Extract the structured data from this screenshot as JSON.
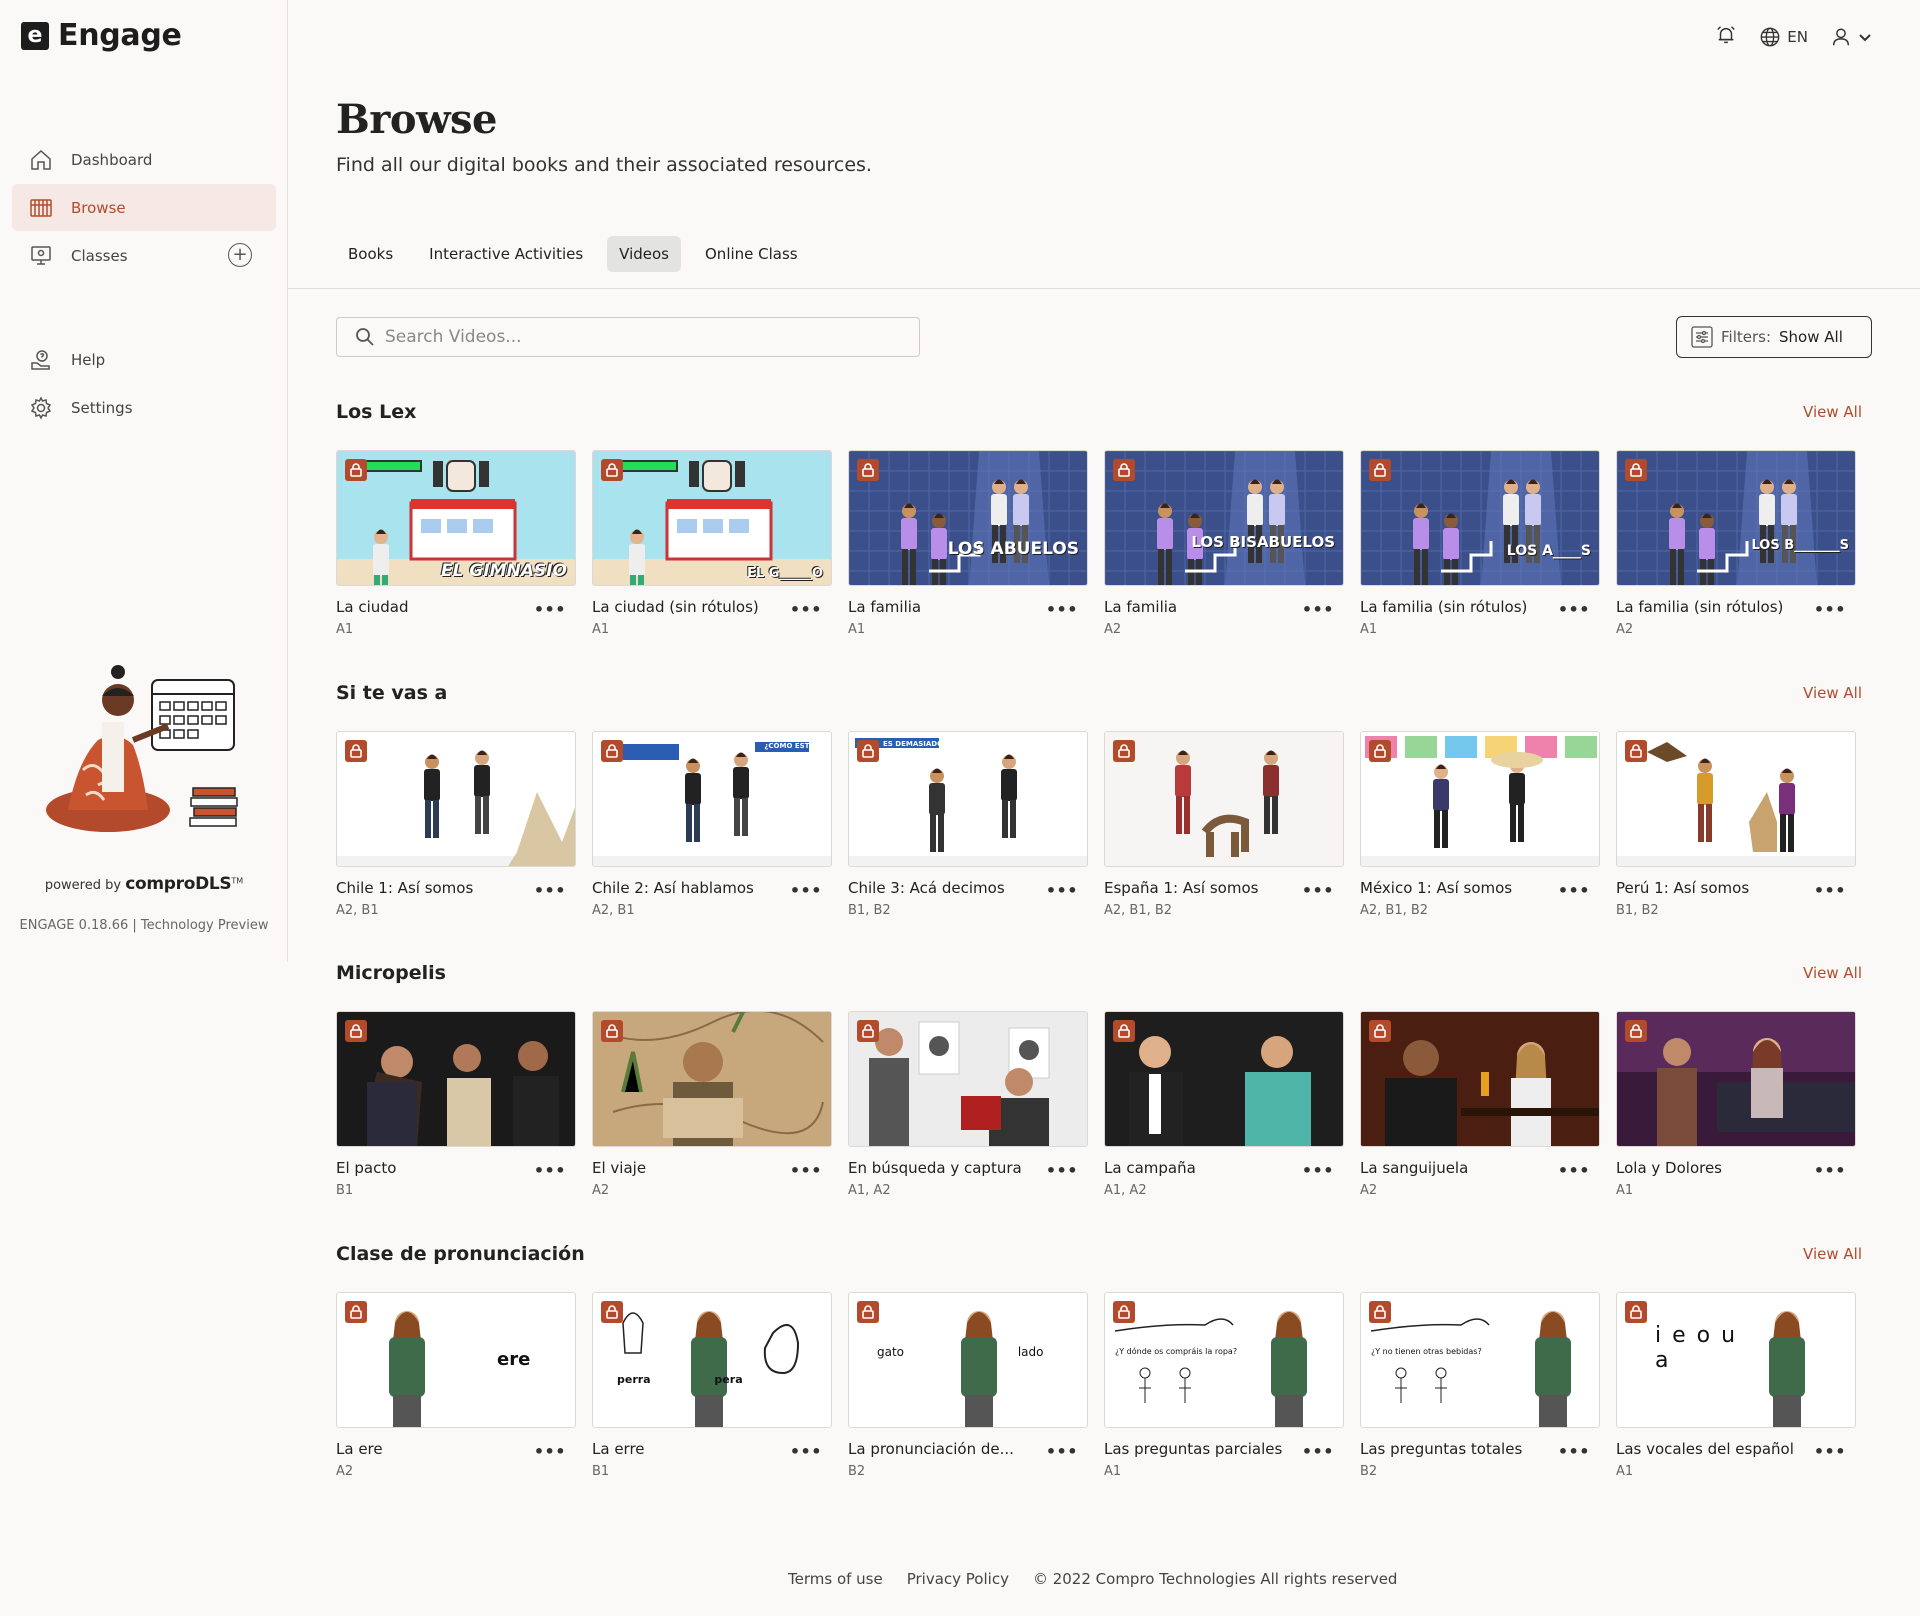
{
  "app": {
    "name": "Engage",
    "logo_letter": "e"
  },
  "topbar": {
    "language": "EN"
  },
  "sidebar": {
    "items": [
      {
        "label": "Dashboard",
        "icon": "home-icon"
      },
      {
        "label": "Browse",
        "icon": "browse-icon",
        "active": true
      },
      {
        "label": "Classes",
        "icon": "classes-icon"
      }
    ],
    "items2": [
      {
        "label": "Help",
        "icon": "help-icon"
      },
      {
        "label": "Settings",
        "icon": "gear-icon"
      }
    ],
    "powered_prefix": "powered by",
    "powered_brand": "comproDLS",
    "powered_tm": "TM",
    "version": "ENGAGE 0.18.66 | Technology Preview"
  },
  "header": {
    "title": "Browse",
    "subtitle": "Find all our digital books and their associated resources."
  },
  "tabs": [
    {
      "label": "Books"
    },
    {
      "label": "Interactive Activities"
    },
    {
      "label": "Videos",
      "active": true
    },
    {
      "label": "Online Class"
    }
  ],
  "search": {
    "placeholder": "Search Videos..."
  },
  "filter": {
    "label": "Filters:",
    "value": "Show All"
  },
  "view_all_label": "View All",
  "more_label": "•••",
  "sections": [
    {
      "title": "Los Lex",
      "cards": [
        {
          "title": "La ciudad",
          "level": "A1",
          "thumb_text": "EL GIMNASIO"
        },
        {
          "title": "La ciudad (sin rótulos)",
          "level": "A1",
          "thumb_text": "EL G_____O"
        },
        {
          "title": "La familia",
          "level": "A1",
          "thumb_text": "LOS ABUELOS"
        },
        {
          "title": "La familia",
          "level": "A2",
          "thumb_text": "LOS BISABUELOS"
        },
        {
          "title": "La familia (sin rótulos)",
          "level": "A1",
          "thumb_text": "LOS A____S"
        },
        {
          "title": "La familia (sin rótulos)",
          "level": "A2",
          "thumb_text": "LOS B_______S"
        }
      ]
    },
    {
      "title": "Si te vas a",
      "cards": [
        {
          "title": "Chile 1: Así somos",
          "level": "A2, B1",
          "thumb_text": ""
        },
        {
          "title": "Chile 2: Así hablamos",
          "level": "A2, B1",
          "thumb_text": "¿CÓMO ESTÁI?"
        },
        {
          "title": "Chile 3: Acá decimos",
          "level": "B1, B2",
          "thumb_text": "ES DEMASIADO BACÁN"
        },
        {
          "title": "España 1: Así somos",
          "level": "A2, B1, B2",
          "thumb_text": ""
        },
        {
          "title": "México 1: Así somos",
          "level": "A2, B1, B2",
          "thumb_text": ""
        },
        {
          "title": "Perú 1: Así somos",
          "level": "B1, B2",
          "thumb_text": ""
        }
      ]
    },
    {
      "title": "Micropelis",
      "cards": [
        {
          "title": "El pacto",
          "level": "B1",
          "thumb_text": ""
        },
        {
          "title": "El viaje",
          "level": "A2",
          "thumb_text": ""
        },
        {
          "title": "En búsqueda y captura",
          "level": "A1, A2",
          "thumb_text": ""
        },
        {
          "title": "La campaña",
          "level": "A1, A2",
          "thumb_text": ""
        },
        {
          "title": "La sanguijuela",
          "level": "A2",
          "thumb_text": ""
        },
        {
          "title": "Lola y Dolores",
          "level": "A1",
          "thumb_text": ""
        }
      ]
    },
    {
      "title": "Clase de pronunciación",
      "cards": [
        {
          "title": "La ere",
          "level": "A2",
          "thumb_text": "ere"
        },
        {
          "title": "La erre",
          "level": "B1",
          "thumb_text": "perra    pera"
        },
        {
          "title": "La pronunciación de...",
          "level": "B2",
          "thumb_text": "gato   lado"
        },
        {
          "title": "Las preguntas parciales",
          "level": "A1",
          "thumb_text": "¿Y dónde os compráis la ropa?"
        },
        {
          "title": "Las preguntas totales",
          "level": "B2",
          "thumb_text": "¿Y no tienen otras bebidas?"
        },
        {
          "title": "Las vocales del español",
          "level": "A1",
          "thumb_text": "i e o u a"
        }
      ]
    }
  ],
  "footer": {
    "terms": "Terms of use",
    "privacy": "Privacy Policy",
    "copyright": "© 2022 Compro Technologies All rights reserved"
  }
}
